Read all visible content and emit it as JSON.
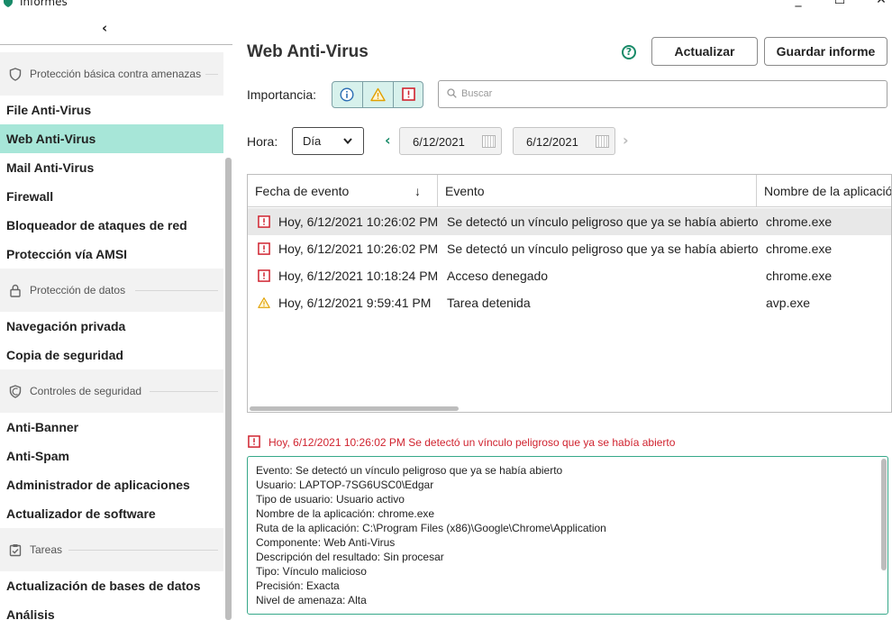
{
  "window": {
    "title": "Informes",
    "controls": {
      "minimize": "_",
      "maximize": "☐",
      "close": "✕"
    }
  },
  "sidebar": {
    "back_glyph": "‹",
    "sections": [
      {
        "title": "Protección básica contra amenazas",
        "icon": "shield-icon"
      },
      {
        "title": "Protección de datos",
        "icon": "lock-icon"
      },
      {
        "title": "Controles de seguridad",
        "icon": "security-controls-icon"
      },
      {
        "title": "Tareas",
        "icon": "tasks-icon"
      }
    ],
    "items": [
      {
        "label": "File Anti-Virus",
        "active": false
      },
      {
        "label": "Web Anti-Virus",
        "active": true
      },
      {
        "label": "Mail Anti-Virus",
        "active": false
      },
      {
        "label": "Firewall",
        "active": false
      },
      {
        "label": "Bloqueador de ataques de red",
        "active": false
      },
      {
        "label": "Protección vía AMSI",
        "active": false
      },
      {
        "label": "Navegación privada",
        "active": false
      },
      {
        "label": "Copia de seguridad",
        "active": false
      },
      {
        "label": "Anti-Banner",
        "active": false
      },
      {
        "label": "Anti-Spam",
        "active": false
      },
      {
        "label": "Administrador de aplicaciones",
        "active": false
      },
      {
        "label": "Actualizador de software",
        "active": false
      },
      {
        "label": "Actualización de bases de datos",
        "active": false
      },
      {
        "label": "Análisis",
        "active": false
      }
    ]
  },
  "header": {
    "title": "Web Anti-Virus",
    "help_glyph": "?",
    "update_button": "Actualizar",
    "save_button": "Guardar informe"
  },
  "filters": {
    "importance_label": "Importancia:",
    "importance_levels": [
      "info",
      "warning",
      "critical"
    ],
    "search_placeholder": "Buscar",
    "time_label": "Hora:",
    "period_value": "Día",
    "date_from": "6/12/2021",
    "date_to": "6/12/2021",
    "prev_glyph": "‹",
    "next_glyph": "›"
  },
  "table": {
    "columns": [
      "Fecha de evento",
      "Evento",
      "Nombre de la aplicación"
    ],
    "sort_glyph": "↓",
    "rows": [
      {
        "severity": "critical",
        "date": "Hoy, 6/12/2021 10:26:02 PM",
        "event": "Se detectó un vínculo peligroso que ya se había abierto",
        "app": "chrome.exe",
        "selected": true
      },
      {
        "severity": "critical",
        "date": "Hoy, 6/12/2021 10:26:02 PM",
        "event": "Se detectó un vínculo peligroso que ya se había abierto",
        "app": "chrome.exe",
        "selected": false
      },
      {
        "severity": "critical",
        "date": "Hoy, 6/12/2021 10:18:24 PM",
        "event": "Acceso denegado",
        "app": "chrome.exe",
        "selected": false
      },
      {
        "severity": "warning",
        "date": "Hoy, 6/12/2021 9:59:41 PM",
        "event": "Tarea detenida",
        "app": "avp.exe",
        "selected": false
      }
    ]
  },
  "detail": {
    "title": "Hoy, 6/12/2021 10:26:02 PM Se detectó un vínculo peligroso que ya se había abierto",
    "lines": [
      "Evento: Se detectó un vínculo peligroso que ya se había abierto",
      "Usuario: LAPTOP-7SG6USC0\\Edgar",
      "Tipo de usuario: Usuario activo",
      "Nombre de la aplicación: chrome.exe",
      "Ruta de la aplicación: C:\\Program Files (x86)\\Google\\Chrome\\Application",
      "Componente: Web Anti-Virus",
      "Descripción del resultado: Sin procesar",
      "Tipo: Vínculo malicioso",
      "Precisión: Exacta",
      "Nivel de amenaza: Alta"
    ]
  },
  "colors": {
    "accent": "#188a68",
    "active_item": "#a7e6d8",
    "critical": "#d0232f",
    "warning": "#e0a000"
  }
}
